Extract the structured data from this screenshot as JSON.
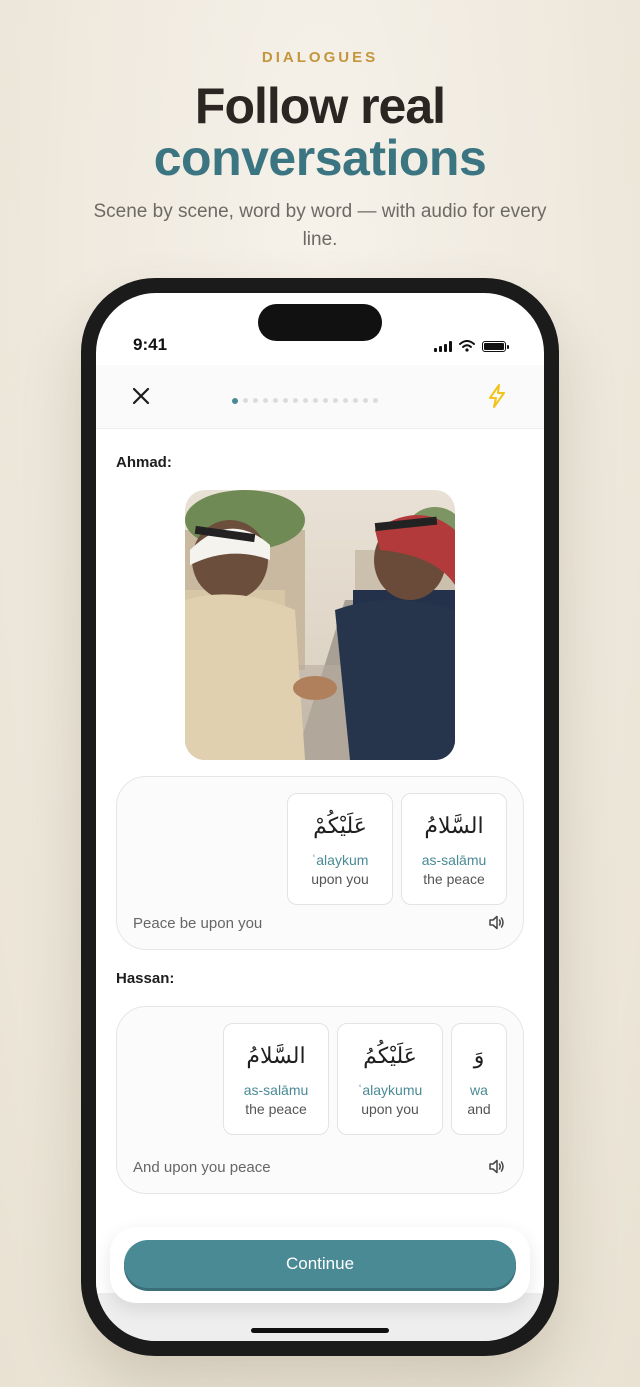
{
  "hero": {
    "eyebrow": "DIALOGUES",
    "title_line1": "Follow real",
    "title_line2": "conversations",
    "subtitle": "Scene by scene, word by word — with audio for every line."
  },
  "status_bar": {
    "time": "9:41"
  },
  "lesson": {
    "total_steps": 15,
    "current_step": 1,
    "dialogue": [
      {
        "speaker": "Ahmad:",
        "translation": "Peace be upon you",
        "words": [
          {
            "arabic": "عَلَيْكُمْ",
            "translit": "ʿalaykum",
            "english": "upon you"
          },
          {
            "arabic": "السَّلامُ",
            "translit": "as-salāmu",
            "english": "the peace"
          }
        ]
      },
      {
        "speaker": "Hassan:",
        "translation": "And upon you peace",
        "words": [
          {
            "arabic": "السَّلامُ",
            "translit": "as-salāmu",
            "english": "the peace"
          },
          {
            "arabic": "عَلَيْكُمُ",
            "translit": "ʿalaykumu",
            "english": "upon you"
          },
          {
            "arabic": "وَ",
            "translit": "wa",
            "english": "and"
          }
        ]
      }
    ]
  },
  "actions": {
    "continue_label": "Continue"
  },
  "colors": {
    "accent": "#4a8a95",
    "gold": "#c3963c",
    "bolt": "#f2c31b"
  },
  "icons": [
    "close-icon",
    "bolt-icon",
    "speaker-icon",
    "signal-icon",
    "wifi-icon",
    "battery-icon"
  ]
}
